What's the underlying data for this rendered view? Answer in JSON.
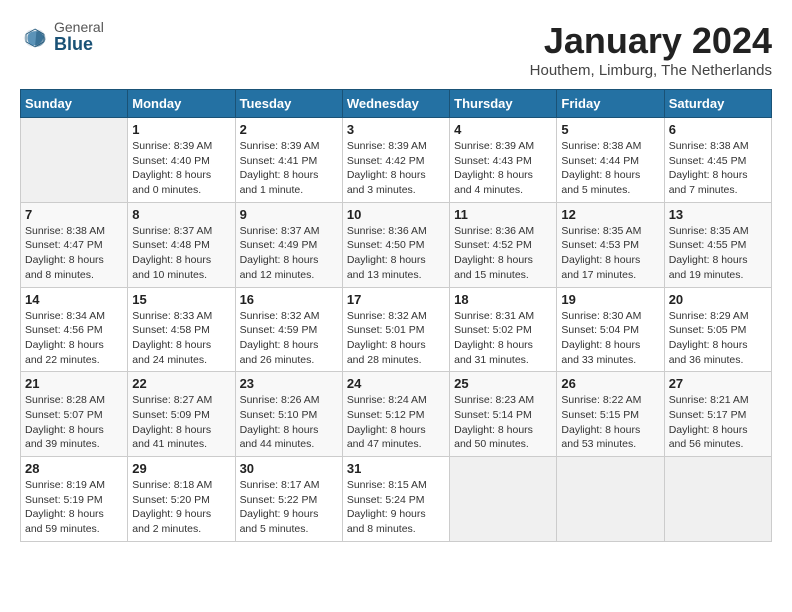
{
  "header": {
    "logo_line1": "General",
    "logo_line2": "Blue",
    "month_title": "January 2024",
    "location": "Houthem, Limburg, The Netherlands"
  },
  "days_of_week": [
    "Sunday",
    "Monday",
    "Tuesday",
    "Wednesday",
    "Thursday",
    "Friday",
    "Saturday"
  ],
  "weeks": [
    [
      {
        "day": "",
        "info": ""
      },
      {
        "day": "1",
        "info": "Sunrise: 8:39 AM\nSunset: 4:40 PM\nDaylight: 8 hours\nand 0 minutes."
      },
      {
        "day": "2",
        "info": "Sunrise: 8:39 AM\nSunset: 4:41 PM\nDaylight: 8 hours\nand 1 minute."
      },
      {
        "day": "3",
        "info": "Sunrise: 8:39 AM\nSunset: 4:42 PM\nDaylight: 8 hours\nand 3 minutes."
      },
      {
        "day": "4",
        "info": "Sunrise: 8:39 AM\nSunset: 4:43 PM\nDaylight: 8 hours\nand 4 minutes."
      },
      {
        "day": "5",
        "info": "Sunrise: 8:38 AM\nSunset: 4:44 PM\nDaylight: 8 hours\nand 5 minutes."
      },
      {
        "day": "6",
        "info": "Sunrise: 8:38 AM\nSunset: 4:45 PM\nDaylight: 8 hours\nand 7 minutes."
      }
    ],
    [
      {
        "day": "7",
        "info": "Sunrise: 8:38 AM\nSunset: 4:47 PM\nDaylight: 8 hours\nand 8 minutes."
      },
      {
        "day": "8",
        "info": "Sunrise: 8:37 AM\nSunset: 4:48 PM\nDaylight: 8 hours\nand 10 minutes."
      },
      {
        "day": "9",
        "info": "Sunrise: 8:37 AM\nSunset: 4:49 PM\nDaylight: 8 hours\nand 12 minutes."
      },
      {
        "day": "10",
        "info": "Sunrise: 8:36 AM\nSunset: 4:50 PM\nDaylight: 8 hours\nand 13 minutes."
      },
      {
        "day": "11",
        "info": "Sunrise: 8:36 AM\nSunset: 4:52 PM\nDaylight: 8 hours\nand 15 minutes."
      },
      {
        "day": "12",
        "info": "Sunrise: 8:35 AM\nSunset: 4:53 PM\nDaylight: 8 hours\nand 17 minutes."
      },
      {
        "day": "13",
        "info": "Sunrise: 8:35 AM\nSunset: 4:55 PM\nDaylight: 8 hours\nand 19 minutes."
      }
    ],
    [
      {
        "day": "14",
        "info": "Sunrise: 8:34 AM\nSunset: 4:56 PM\nDaylight: 8 hours\nand 22 minutes."
      },
      {
        "day": "15",
        "info": "Sunrise: 8:33 AM\nSunset: 4:58 PM\nDaylight: 8 hours\nand 24 minutes."
      },
      {
        "day": "16",
        "info": "Sunrise: 8:32 AM\nSunset: 4:59 PM\nDaylight: 8 hours\nand 26 minutes."
      },
      {
        "day": "17",
        "info": "Sunrise: 8:32 AM\nSunset: 5:01 PM\nDaylight: 8 hours\nand 28 minutes."
      },
      {
        "day": "18",
        "info": "Sunrise: 8:31 AM\nSunset: 5:02 PM\nDaylight: 8 hours\nand 31 minutes."
      },
      {
        "day": "19",
        "info": "Sunrise: 8:30 AM\nSunset: 5:04 PM\nDaylight: 8 hours\nand 33 minutes."
      },
      {
        "day": "20",
        "info": "Sunrise: 8:29 AM\nSunset: 5:05 PM\nDaylight: 8 hours\nand 36 minutes."
      }
    ],
    [
      {
        "day": "21",
        "info": "Sunrise: 8:28 AM\nSunset: 5:07 PM\nDaylight: 8 hours\nand 39 minutes."
      },
      {
        "day": "22",
        "info": "Sunrise: 8:27 AM\nSunset: 5:09 PM\nDaylight: 8 hours\nand 41 minutes."
      },
      {
        "day": "23",
        "info": "Sunrise: 8:26 AM\nSunset: 5:10 PM\nDaylight: 8 hours\nand 44 minutes."
      },
      {
        "day": "24",
        "info": "Sunrise: 8:24 AM\nSunset: 5:12 PM\nDaylight: 8 hours\nand 47 minutes."
      },
      {
        "day": "25",
        "info": "Sunrise: 8:23 AM\nSunset: 5:14 PM\nDaylight: 8 hours\nand 50 minutes."
      },
      {
        "day": "26",
        "info": "Sunrise: 8:22 AM\nSunset: 5:15 PM\nDaylight: 8 hours\nand 53 minutes."
      },
      {
        "day": "27",
        "info": "Sunrise: 8:21 AM\nSunset: 5:17 PM\nDaylight: 8 hours\nand 56 minutes."
      }
    ],
    [
      {
        "day": "28",
        "info": "Sunrise: 8:19 AM\nSunset: 5:19 PM\nDaylight: 8 hours\nand 59 minutes."
      },
      {
        "day": "29",
        "info": "Sunrise: 8:18 AM\nSunset: 5:20 PM\nDaylight: 9 hours\nand 2 minutes."
      },
      {
        "day": "30",
        "info": "Sunrise: 8:17 AM\nSunset: 5:22 PM\nDaylight: 9 hours\nand 5 minutes."
      },
      {
        "day": "31",
        "info": "Sunrise: 8:15 AM\nSunset: 5:24 PM\nDaylight: 9 hours\nand 8 minutes."
      },
      {
        "day": "",
        "info": ""
      },
      {
        "day": "",
        "info": ""
      },
      {
        "day": "",
        "info": ""
      }
    ]
  ]
}
